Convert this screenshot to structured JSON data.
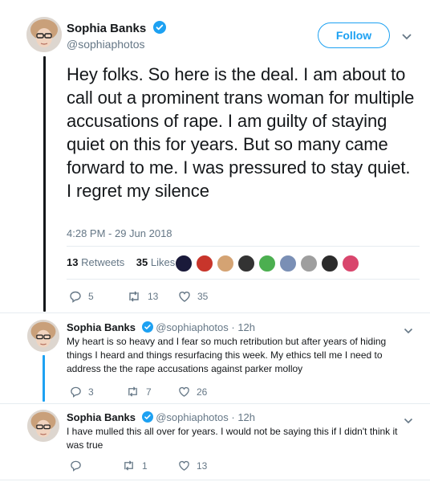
{
  "main_tweet": {
    "author_name": "Sophia Banks",
    "handle": "@sophiaphotos",
    "follow_label": "Follow",
    "text": "Hey folks. So here is the deal. I am about to call out a prominent trans woman for multiple accusations of rape. I am guilty of staying quiet on this for years. But so many came forward to me. I was pressured to stay quiet. I regret my silence",
    "timestamp": "4:28 PM - 29 Jun 2018",
    "retweets_count": "13",
    "retweets_label": "Retweets",
    "likes_count": "35",
    "likes_label": "Likes",
    "reply_count": "5",
    "retweet_action_count": "13",
    "like_action_count": "35"
  },
  "replies": [
    {
      "author_name": "Sophia Banks",
      "handle": "@sophiaphotos",
      "time": "· 12h",
      "text": "My heart is so heavy and I fear so much retribution but after years of hiding things I heard and things resurfacing this week. My ethics tell me I need to address the the rape accusations against parker molloy",
      "reply_count": "3",
      "retweet_count": "7",
      "like_count": "26"
    },
    {
      "author_name": "Sophia Banks",
      "handle": "@sophiaphotos",
      "time": "· 12h",
      "text": "I have mulled this all over for years. I would not be saying this if I didn't think it was true",
      "reply_count": "",
      "retweet_count": "1",
      "like_count": "13"
    }
  ],
  "colors": {
    "brand_blue": "#1da1f2",
    "muted": "#657786",
    "thread_dark": "#14171a",
    "thread_blue": "#1da1f2"
  },
  "icons": [
    "verified-badge-icon",
    "chevron-down-icon",
    "reply-icon",
    "retweet-icon",
    "like-icon"
  ]
}
